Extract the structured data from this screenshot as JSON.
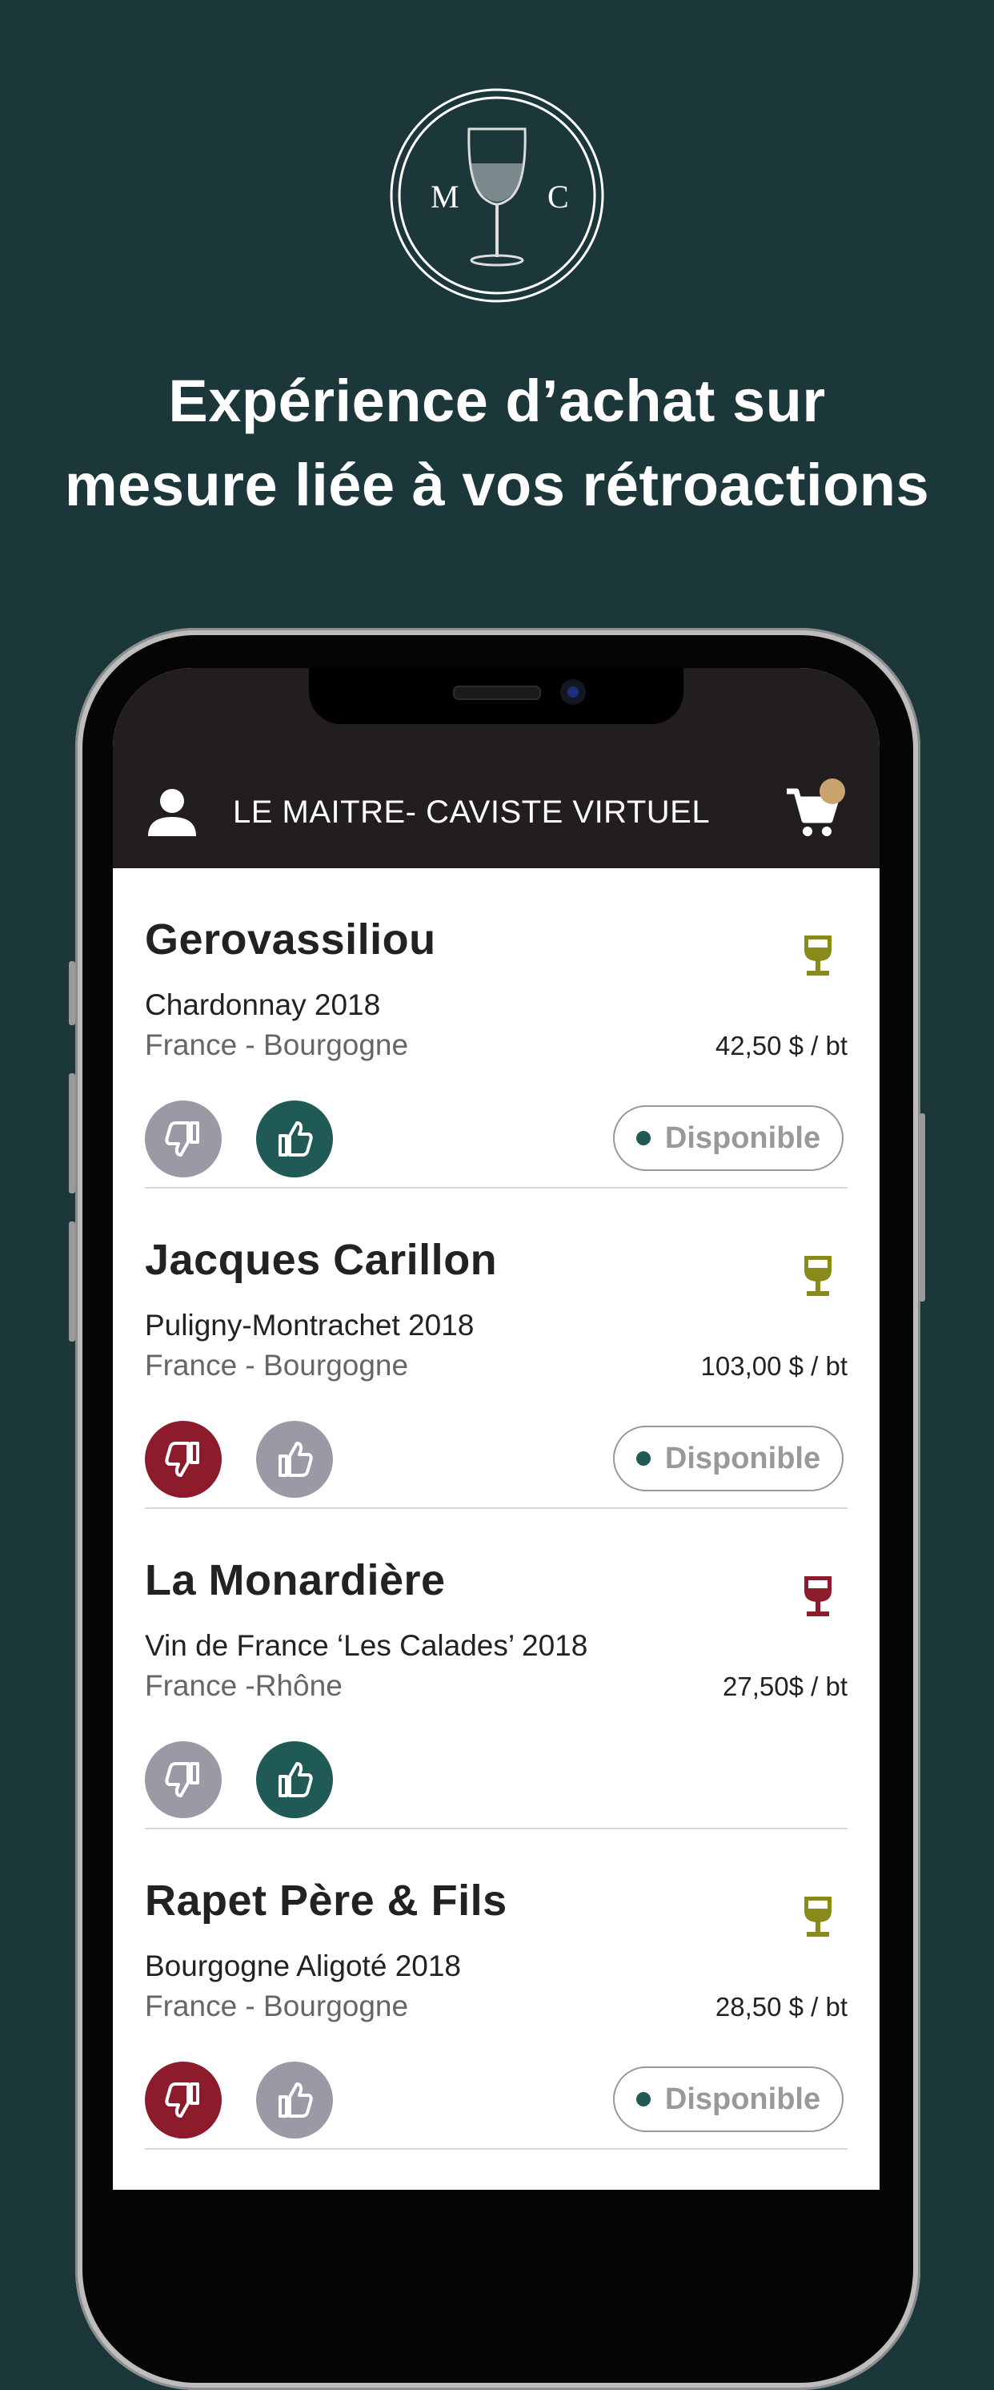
{
  "logo": {
    "letter_left": "M",
    "letter_right": "C",
    "icon": "wine-glass-icon"
  },
  "headline": {
    "line1": "Expérience d’achat sur",
    "line2": "mesure liée à vos rétroactions"
  },
  "app": {
    "title": "LE MAITRE- CAVISTE VIRTUEL",
    "user_icon": "user-icon",
    "cart_icon": "cart-icon"
  },
  "colors": {
    "background": "#1b373a",
    "header": "#221d1f",
    "white_wine": "#8a8a1b",
    "red_wine": "#8c1c2b",
    "active_up": "#1f5a56",
    "active_down": "#8c1c2b",
    "inactive": "#9c99a6"
  },
  "wines": [
    {
      "producer": "Gerovassiliou",
      "cuvee": "Chardonnay 2018",
      "region": "France - Bourgogne",
      "price": "42,50 $ / bt",
      "glass": "white",
      "vote": "up",
      "status": "Disponible"
    },
    {
      "producer": "Jacques Carillon",
      "cuvee": "Puligny-Montrachet 2018",
      "region": "France - Bourgogne",
      "price": "103,00 $ / bt",
      "glass": "white",
      "vote": "down",
      "status": "Disponible"
    },
    {
      "producer": "La Monardière",
      "cuvee": "Vin de France ‘Les Calades’ 2018",
      "region": "France -Rhône",
      "price": "27,50$ / bt",
      "glass": "red",
      "vote": "up",
      "status": ""
    },
    {
      "producer": "Rapet Père & Fils",
      "cuvee": "Bourgogne Aligoté 2018",
      "region": "France - Bourgogne",
      "price": "28,50 $ / bt",
      "glass": "white",
      "vote": "down",
      "status": "Disponible"
    }
  ]
}
